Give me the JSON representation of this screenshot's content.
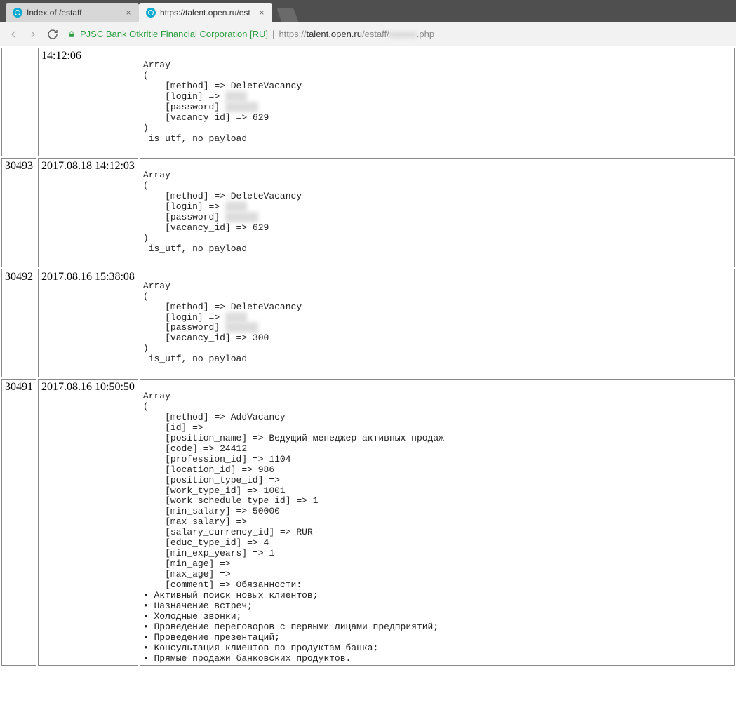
{
  "tabs": [
    {
      "title": "Index of /estaff",
      "active": false
    },
    {
      "title": "https://talent.open.ru/est",
      "active": true
    }
  ],
  "address": {
    "org": "PJSC Bank Otkritie Financial Corporation [RU]",
    "url_prefix": "https://",
    "url_host": "talent.open.ru",
    "url_path_before": "/estaff/",
    "url_blur": "xxxxxx",
    "url_path_after": ".php"
  },
  "rows": [
    {
      "id": "",
      "ts": "14:12:06",
      "pre": "\nArray\n(\n    [method] => DeleteVacancy\n    [login] => ",
      "pre2": "\n    [password] ",
      "pre3": "\n    [vacancy_id] => 629\n)\n is_utf, no payload\n\n"
    },
    {
      "id": "30493",
      "ts": "2017.08.18 14:12:03",
      "pre": "\nArray\n(\n    [method] => DeleteVacancy\n    [login] => ",
      "pre2": "\n    [password] ",
      "pre3": "\n    [vacancy_id] => 629\n)\n is_utf, no payload\n\n"
    },
    {
      "id": "30492",
      "ts": "2017.08.16 15:38:08",
      "pre": "\nArray\n(\n    [method] => DeleteVacancy\n    [login] => ",
      "pre2": "\n    [password] ",
      "pre3": "\n    [vacancy_id] => 300\n)\n is_utf, no payload\n\n"
    },
    {
      "id": "30491",
      "ts": "2017.08.16 10:50:50",
      "pre": "\nArray\n(\n    [method] => AddVacancy\n    [id] => \n    [position_name] => Ведущий менеджер активных продаж\n    [code] => 24412\n    [profession_id] => 1104\n    [location_id] => 986\n    [position_type_id] => \n    [work_type_id] => 1001\n    [work_schedule_type_id] => 1\n    [min_salary] => 50000\n    [max_salary] => \n    [salary_currency_id] => RUR\n    [educ_type_id] => 4\n    [min_exp_years] => 1\n    [min_age] => \n    [max_age] => \n    [comment] => Обязанности:\n• Активный поиск новых клиентов;\n• Назначение встреч;\n• Холодные звонки;\n• Проведение переговоров с первыми лицами предприятий;\n• Проведение презентаций;\n• Консультация клиентов по продуктам банка;\n• Прямые продажи банковских продуктов.",
      "pre2": "",
      "pre3": "",
      "noblur": true
    }
  ]
}
